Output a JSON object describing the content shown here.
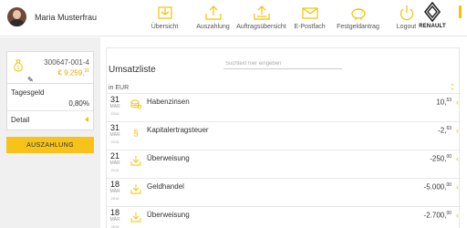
{
  "user": {
    "name": "Maria Musterfrau"
  },
  "nav": [
    {
      "label": "Übersicht",
      "icon": "overview-icon"
    },
    {
      "label": "Auszahlung",
      "icon": "payout-icon"
    },
    {
      "label": "Auftragsübersicht",
      "icon": "orders-icon"
    },
    {
      "label": "E-Postfach",
      "icon": "mail-icon"
    },
    {
      "label": "Festgeldantrag",
      "icon": "piggy-bank-icon"
    },
    {
      "label": "Logout",
      "icon": "power-icon"
    }
  ],
  "brand": {
    "name": "RENAULT",
    "accent": "#f2c200"
  },
  "account": {
    "number": "300647-001-4",
    "balance_main": "€ 9.259,",
    "balance_cents": "31",
    "type_label": "Tagesgeld",
    "rate": "0,80%",
    "detail_label": "Detail",
    "payout_button": "AUSZAHLUNG"
  },
  "transactions_panel": {
    "title": "Umsatzliste",
    "search_placeholder": "Suchtext hier eingeben",
    "currency_label": "in EUR"
  },
  "transactions": [
    {
      "day": "31",
      "month": "MÄR",
      "year": "2016",
      "name": "Habenzinsen",
      "amount_main": "10,",
      "amount_cents": "53",
      "icon": "coins-icon"
    },
    {
      "day": "31",
      "month": "MÄR",
      "year": "2016",
      "name": "Kapitalertragsteuer",
      "amount_main": "-2,",
      "amount_cents": "63",
      "icon": "paragraph-icon"
    },
    {
      "day": "21",
      "month": "MÄR",
      "year": "2016",
      "name": "Überweisung",
      "amount_main": "-250,",
      "amount_cents": "00",
      "icon": "transfer-icon"
    },
    {
      "day": "18",
      "month": "MÄR",
      "year": "2016",
      "name": "Geldhandel",
      "amount_main": "-5.000,",
      "amount_cents": "00",
      "icon": "transfer-icon"
    },
    {
      "day": "18",
      "month": "MÄR",
      "year": "2016",
      "name": "Überweisung",
      "amount_main": "-2.700,",
      "amount_cents": "00",
      "icon": "transfer-icon"
    }
  ]
}
